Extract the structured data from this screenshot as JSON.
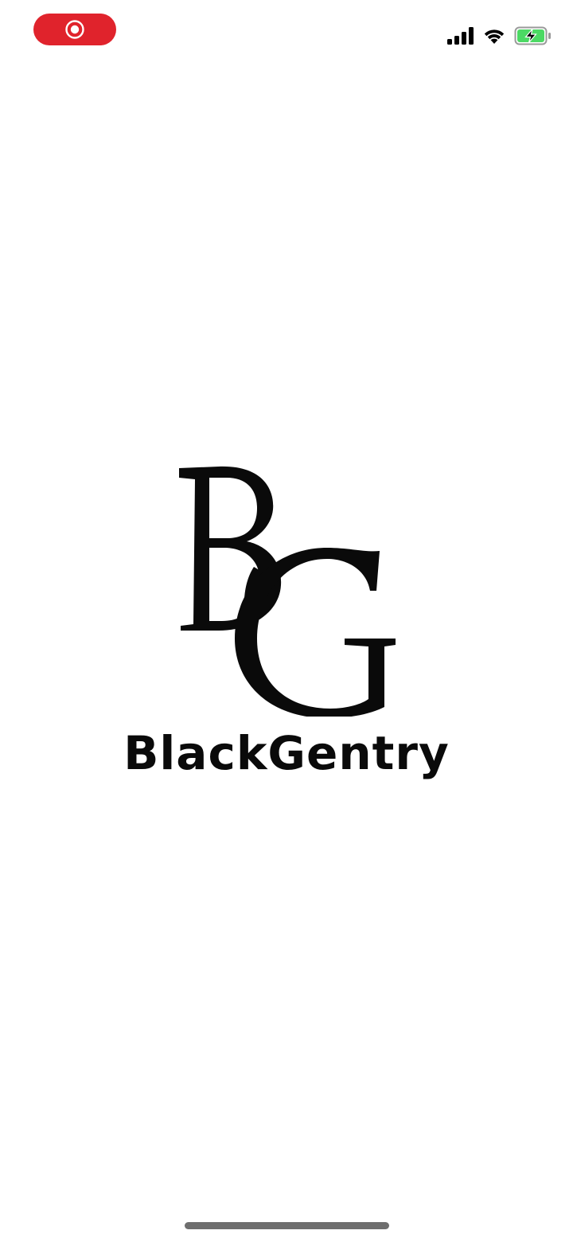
{
  "status_bar": {
    "record_color": "#e0232c",
    "icons": [
      "screen-record-icon",
      "cellular-signal-icon",
      "wifi-icon",
      "battery-charging-icon"
    ]
  },
  "splash": {
    "logo_monogram": "BG",
    "brand_name": "BlackGentry"
  },
  "colors": {
    "background": "#ffffff",
    "logo": "#0a0a0a",
    "battery_fill": "#4cd964",
    "home_indicator": "#6e6e6e"
  }
}
